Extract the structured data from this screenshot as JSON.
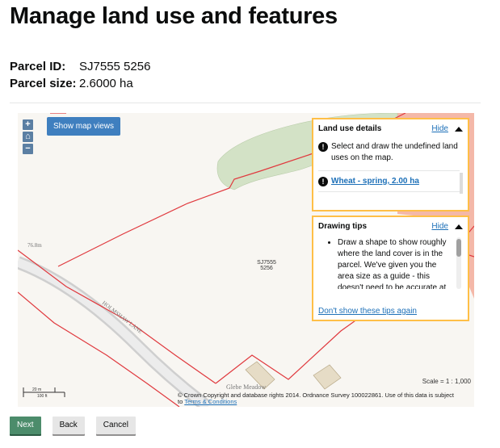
{
  "page": {
    "title": "Manage land use and features"
  },
  "parcel": {
    "id_label": "Parcel ID:",
    "id_value": "SJ7555 5256",
    "size_label": "Parcel size:",
    "size_value": "2.6000 ha"
  },
  "map": {
    "show_views_label": "Show map views",
    "zoom_in": "+",
    "zoom_out": "−",
    "parcel_label_line1": "SJ7555",
    "parcel_label_line2": "5256",
    "elevation_label": "76.8m",
    "road_label": "HOLMSHAW LANE",
    "building_label": "Glebe Meadow",
    "scale_text": "Scale = 1 : 1,000",
    "scale_bar_m": "20 m",
    "scale_bar_ft": "100 ft",
    "copyright_text": "© Crown Copyright and database rights 2014. Ordnance Survey 100022861. Use of this data is subject",
    "copyright_to": "to",
    "terms_link": "Terms & Conditions"
  },
  "land_use_panel": {
    "title": "Land use details",
    "hide_label": "Hide",
    "instruction": "Select and draw the undefined land uses on the map.",
    "item_label": "Wheat - spring, 2.00 ha"
  },
  "tips_panel": {
    "title": "Drawing tips",
    "hide_label": "Hide",
    "tip_text": "Draw a shape to show roughly where the land cover is in the parcel. We've given you the area size as a guide - this doesn't need to be accurate at this stage.",
    "dont_show_label": "Don't show these tips again"
  },
  "buttons": {
    "next": "Next",
    "back": "Back",
    "cancel": "Cancel"
  },
  "colors": {
    "accent_blue": "#1d70b8",
    "panel_border": "#ffbf47",
    "next_green": "#4c8c6b",
    "boundary_red": "#e0393e"
  }
}
